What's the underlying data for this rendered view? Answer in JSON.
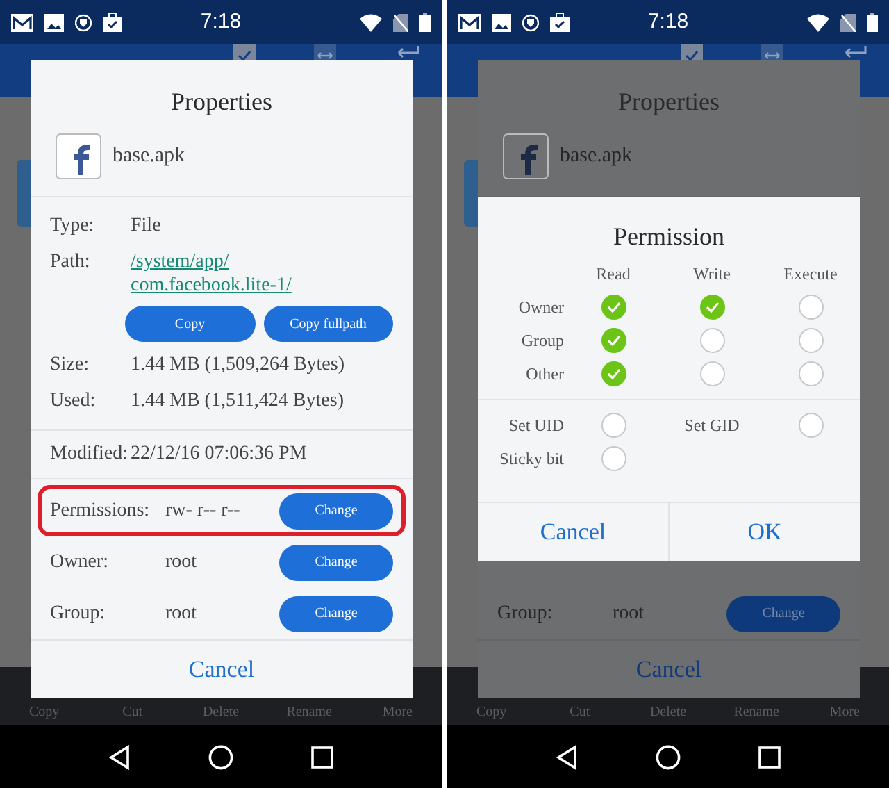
{
  "screens": [
    {
      "status_bar": {
        "time": "7:18"
      },
      "dimmed": false,
      "properties": {
        "title": "Properties",
        "file_name": "base.apk",
        "details": [
          {
            "kind": "text",
            "label": "Type:",
            "value": "File"
          },
          {
            "kind": "link",
            "label": "Path:",
            "value_lines": [
              "/system/app/",
              "com.facebook.lite-1/"
            ],
            "buttons": [
              "Copy",
              "Copy fullpath"
            ]
          },
          {
            "kind": "text",
            "label": "Size:",
            "value": "1.44 MB (1,509,264 Bytes)"
          },
          {
            "kind": "text",
            "label": "Used:",
            "value": "1.44 MB (1,511,424 Bytes)"
          }
        ],
        "modified": {
          "label": "Modified:",
          "value": "22/12/16 07:06:36 PM"
        },
        "access": [
          {
            "label": "Permissions:",
            "value": "rw- r-- r--",
            "button": "Change",
            "highlighted": true
          },
          {
            "label": "Owner:",
            "value": "root",
            "button": "Change",
            "highlighted": false
          },
          {
            "label": "Group:",
            "value": "root",
            "button": "Change",
            "highlighted": false
          }
        ],
        "cancel": "Cancel"
      },
      "toolbar": [
        "Copy",
        "Cut",
        "Delete",
        "Rename",
        "More"
      ]
    },
    {
      "status_bar": {
        "time": "7:18"
      },
      "dimmed": true,
      "properties": {
        "title": "Properties",
        "file_name": "base.apk",
        "access": [
          {
            "label": "Group:",
            "value": "root",
            "button": "Change",
            "highlighted": false
          }
        ],
        "cancel": "Cancel"
      },
      "toolbar": [
        "Copy",
        "Cut",
        "Delete",
        "Rename",
        "More"
      ],
      "permission_dialog": {
        "title": "Permission",
        "columns": [
          "Read",
          "Write",
          "Execute"
        ],
        "rows": [
          {
            "label": "Owner",
            "cells": [
              {
                "checked": true
              },
              {
                "checked": true
              },
              {
                "checked": false
              }
            ]
          },
          {
            "label": "Group",
            "cells": [
              {
                "checked": true
              },
              {
                "checked": false
              },
              {
                "checked": false
              }
            ]
          },
          {
            "label": "Other",
            "cells": [
              {
                "checked": true
              },
              {
                "checked": false
              },
              {
                "checked": false
              }
            ]
          }
        ],
        "special": [
          {
            "label": "Set UID",
            "checked": false
          },
          {
            "label": "Set GID",
            "checked": false
          },
          {
            "label": "Sticky bit",
            "checked": false
          }
        ],
        "buttons": [
          "Cancel",
          "OK"
        ]
      }
    }
  ]
}
